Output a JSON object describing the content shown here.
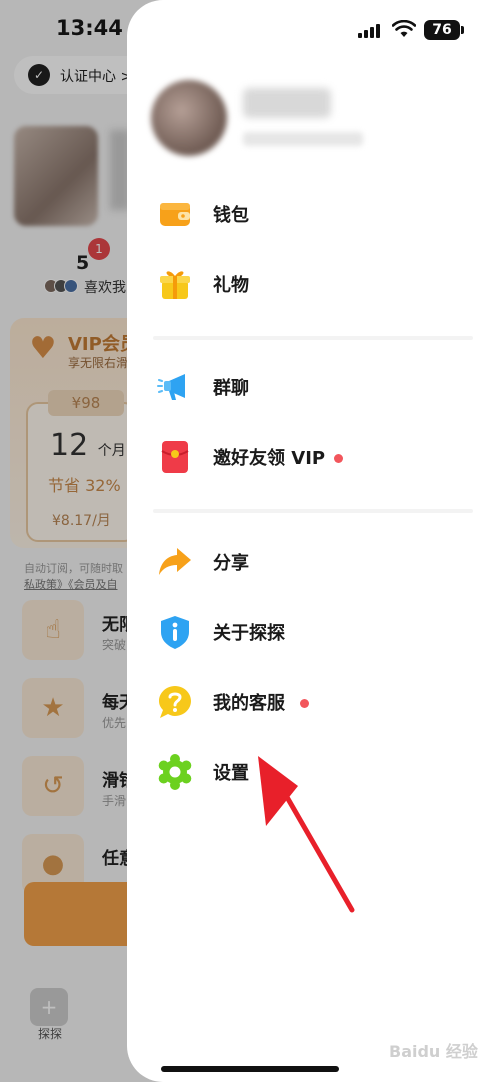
{
  "status_bar": {
    "time": "13:44",
    "battery": "76"
  },
  "background": {
    "cert_label": "认证中心 >",
    "likes_count": "5",
    "likes_badge": "1",
    "likes_label": "喜欢我",
    "vip_title": "VIP会员",
    "vip_subtitle": "享无限右滑",
    "plan_price_tag": "¥98",
    "plan_months": "12",
    "plan_months_unit": "个月",
    "plan_save": "节省 32%",
    "plan_per_month": "¥8.17/月",
    "terms_line1": "自动订阅，可随时取",
    "terms_line2": "私政策》《会员及自",
    "features": [
      {
        "title": "无限",
        "sub": "突破"
      },
      {
        "title": "每天",
        "sub": "优先"
      },
      {
        "title": "滑错",
        "sub": "手滑"
      },
      {
        "title": "任意",
        "sub": ""
      }
    ],
    "tab_label": "探探"
  },
  "drawer": {
    "menu": [
      {
        "id": "wallet",
        "label": "钱包",
        "icon": "wallet-icon",
        "dot": false
      },
      {
        "id": "gift",
        "label": "礼物",
        "icon": "gift-icon",
        "dot": false
      },
      {
        "id": "group-chat",
        "label": "群聊",
        "icon": "megaphone-icon",
        "dot": false
      },
      {
        "id": "invite",
        "label": "邀好友领 VIP",
        "icon": "red-envelope-icon",
        "dot": true
      },
      {
        "id": "share",
        "label": "分享",
        "icon": "share-arrow-icon",
        "dot": false
      },
      {
        "id": "about",
        "label": "关于探探",
        "icon": "info-shield-icon",
        "dot": false
      },
      {
        "id": "support",
        "label": "我的客服",
        "icon": "help-bubble-icon",
        "dot": true
      },
      {
        "id": "settings",
        "label": "设置",
        "icon": "gear-icon",
        "dot": false
      }
    ]
  },
  "watermark": "Baidu 经验",
  "colors": {
    "dot": "#f2565c",
    "arrow": "#e8202a",
    "wallet": "#f7a11a",
    "gift": "#f7c81a",
    "megaphone": "#2ea3f2",
    "envelope": "#ef3b48",
    "share": "#f7a11a",
    "info": "#2ea3f2",
    "help": "#f7c81a",
    "gear": "#6cd11f"
  }
}
